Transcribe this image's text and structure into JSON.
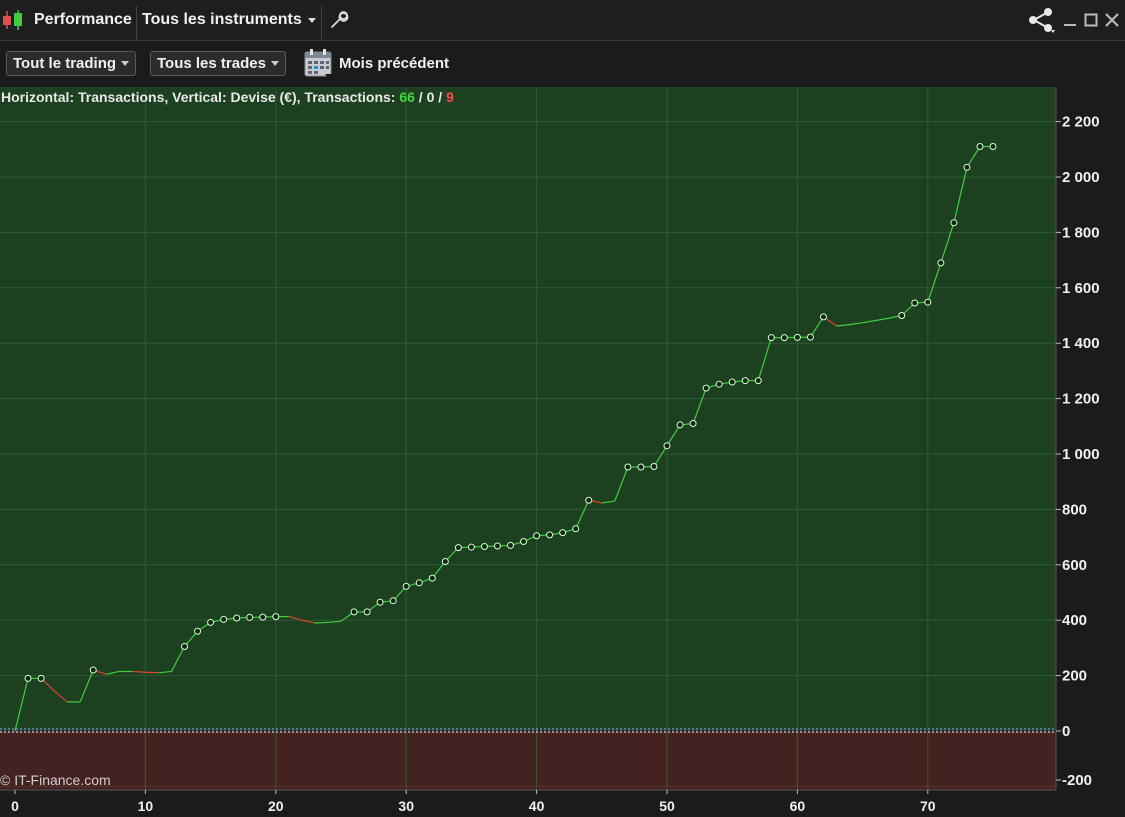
{
  "window": {
    "title": "Performance",
    "instrument_label": "Tous les instruments"
  },
  "toolbar": {
    "trading_filter": "Tout le trading",
    "trades_filter": "Tous les trades",
    "period_label": "Mois précédent"
  },
  "chart_header": {
    "prefix": "Horizontal: Transactions, Vertical: Devise (€), Transactions: ",
    "wins": "66",
    "sep1": " / ",
    "flat": "0",
    "sep2": " / ",
    "losses": "9"
  },
  "watermark": "© IT-Finance.com",
  "colors": {
    "positive_zone": "#1d4020",
    "negative_zone": "#452222",
    "up_line": "#3ecf3e",
    "down_line": "#e0452e",
    "grid": "#2f5a33"
  },
  "icons": {
    "app": "candlestick-icon",
    "settings": "wrench-icon",
    "share": "share-icon",
    "minimize": "minimize-icon",
    "maximize": "maximize-icon",
    "close": "close-icon",
    "calendar": "calendar-icon"
  },
  "chart_data": {
    "type": "line",
    "title": "",
    "xlabel": "Transactions",
    "ylabel": "Devise (€)",
    "xlim": [
      0,
      80
    ],
    "ylim": [
      -220,
      2320
    ],
    "x_ticks": [
      "0",
      "10",
      "20",
      "30",
      "40",
      "50",
      "60",
      "70"
    ],
    "y_ticks": [
      "2 200",
      "2 000",
      "1 800",
      "1 600",
      "1 400",
      "1 200",
      "1 000",
      "800",
      "600",
      "400",
      "200",
      "0",
      "-200"
    ],
    "grid": true,
    "x": [
      0,
      1,
      2,
      3,
      4,
      5,
      6,
      7,
      8,
      9,
      10,
      11,
      12,
      13,
      14,
      15,
      16,
      17,
      18,
      19,
      20,
      21,
      22,
      23,
      24,
      25,
      26,
      27,
      28,
      29,
      30,
      31,
      32,
      33,
      34,
      35,
      36,
      37,
      38,
      39,
      40,
      41,
      42,
      43,
      44,
      45,
      46,
      47,
      48,
      49,
      50,
      51,
      52,
      53,
      54,
      55,
      56,
      57,
      58,
      59,
      60,
      61,
      62,
      63,
      64,
      65,
      66,
      67,
      68,
      69,
      70,
      71,
      72,
      73,
      74,
      75
    ],
    "values": [
      0,
      190,
      190,
      145,
      105,
      105,
      220,
      205,
      215,
      215,
      212,
      210,
      215,
      305,
      360,
      392,
      403,
      408,
      410,
      411,
      413,
      413,
      400,
      390,
      392,
      396,
      430,
      430,
      465,
      470,
      522,
      535,
      552,
      612,
      662,
      664,
      666,
      668,
      670,
      684,
      705,
      708,
      716,
      730,
      833,
      823,
      830,
      953,
      953,
      955,
      1030,
      1105,
      1110,
      1238,
      1252,
      1260,
      1265,
      1265,
      1420,
      1420,
      1421,
      1422,
      1495,
      1462,
      1467,
      1474,
      1482,
      1490,
      1500,
      1545,
      1548,
      1690,
      1835,
      2035,
      2110,
      2110
    ],
    "markers": [
      1,
      2,
      6,
      13,
      14,
      15,
      16,
      17,
      18,
      19,
      20,
      26,
      27,
      28,
      29,
      30,
      31,
      32,
      33,
      34,
      35,
      36,
      37,
      38,
      39,
      40,
      41,
      42,
      43,
      44,
      47,
      48,
      49,
      50,
      51,
      52,
      53,
      54,
      55,
      56,
      57,
      58,
      59,
      60,
      61,
      62,
      68,
      69,
      70,
      71,
      72,
      73,
      74,
      75
    ],
    "zero_line": 0
  }
}
